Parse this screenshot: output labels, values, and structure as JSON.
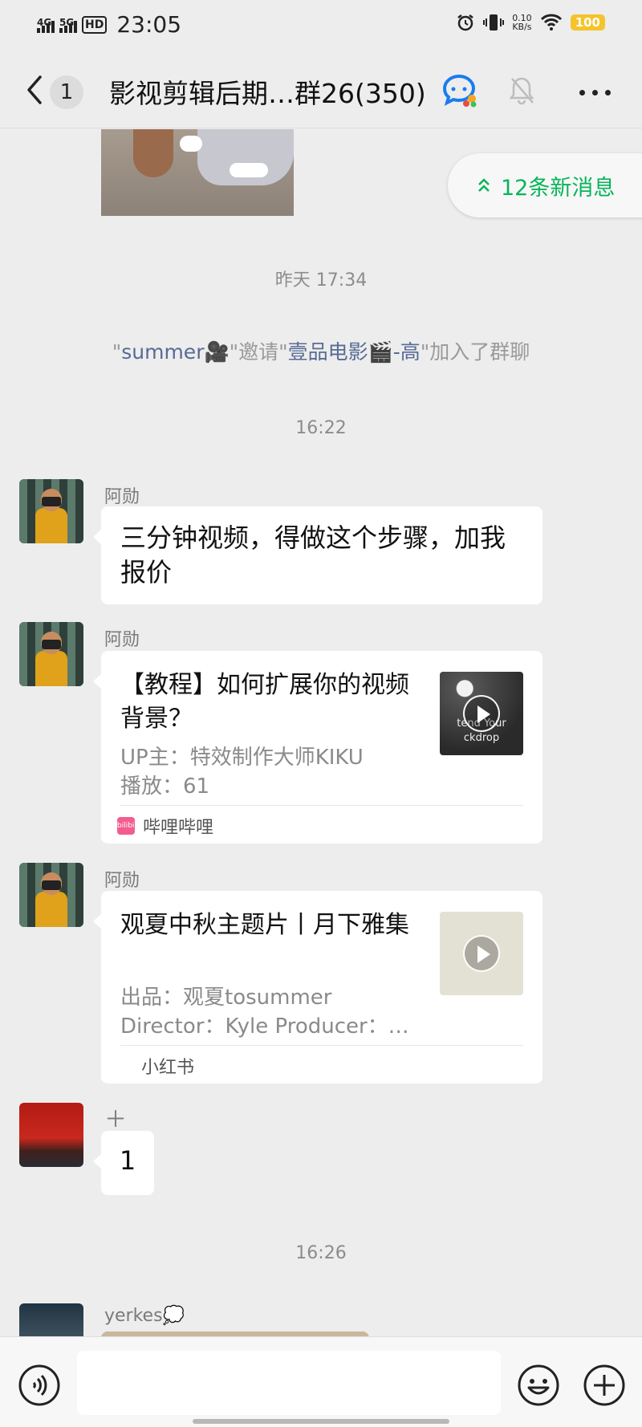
{
  "status_bar": {
    "network_1": "4G",
    "network_2": "5G",
    "hd_badge": "HD",
    "time": "23:05",
    "speed_value": "0.10",
    "speed_unit": "KB/s",
    "battery": "100"
  },
  "header": {
    "unread_count": "1",
    "title": "影视剪辑后期…群26(350)"
  },
  "banner": {
    "new_messages": "12条新消息"
  },
  "system": {
    "time_1": "昨天 17:34",
    "join_q1": "\"",
    "inviter": "summer🎥",
    "join_mid": "\"邀请\"",
    "invitee": "壹品电影🎬-高",
    "join_end": "\"加入了群聊",
    "time_2": "16:22",
    "time_3": "16:26"
  },
  "messages": {
    "m1": {
      "sender": "阿勋",
      "text": "三分钟视频，得做这个步骤，加我报价"
    },
    "m2": {
      "sender": "阿勋",
      "title": "【教程】如何扩展你的视频背景？",
      "line1": "UP主：特效制作大师KIKU",
      "line2": "播放：61",
      "thumb_text": "tend Your\nckdrop",
      "source": "哔哩哔哩",
      "source_icon_text": "bilibili"
    },
    "m3": {
      "sender": "阿勋",
      "title": "观夏中秋主题片丨月下雅集",
      "line1": "出品：观夏tosummer",
      "line2": "Director：Kyle  Producer：…",
      "source": "小红书"
    },
    "m4": {
      "sender": "＋",
      "text": "1"
    },
    "m5": {
      "sender": "yerkes💭"
    }
  },
  "icons": {
    "back": "chevron-left-icon",
    "group_chat": "chat-bubble-color-icon",
    "mute": "bell-off-icon",
    "more": "more-horizontal-icon",
    "new_msg": "double-chevron-up-icon",
    "voice": "voice-icon",
    "emoji": "emoji-icon",
    "plus": "plus-circle-icon"
  },
  "colors": {
    "accent_green": "#07b45a",
    "link_blue": "#576b95",
    "bg": "#ededed"
  }
}
